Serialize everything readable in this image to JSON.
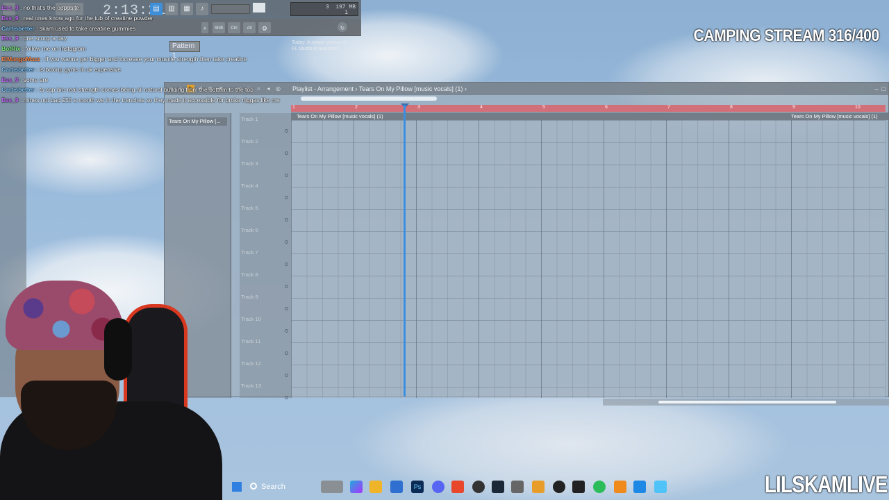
{
  "stream": {
    "title": "CAMPING STREAM 316/400",
    "brand": "LILSKAMLIVE"
  },
  "toolbar": {
    "clock": "2:13:21",
    "clock_sub": "BT",
    "cpu_label": "3",
    "memory": "197 MB",
    "voices": "1",
    "pattern_label": "Pattern 1",
    "update_notice": "Today: A newer version of FL Studio is available!",
    "mode_buttons": [
      "Shift",
      "Ctrl",
      "Alt"
    ]
  },
  "chat": [
    {
      "user": "Ess_9",
      "text": "no that's the opposite",
      "color": "#c86cff"
    },
    {
      "user": "Ess_9",
      "text": "real ones know ago for the tub of creatine powder",
      "color": "#c86cff"
    },
    {
      "user": "Cartisbetter",
      "text": "skam used to take creatine gummies",
      "color": "#7ec8ff"
    },
    {
      "user": "Ess_9",
      "text": "one scoop a day",
      "color": "#c86cff"
    },
    {
      "user": "BotRix",
      "text": "follow me on instagram",
      "color": "#7ef07e"
    },
    {
      "user": "ElMangoMazz",
      "text": "If you wanna get bigger and increase your muscle strength then take creatine",
      "color": "#ff8a4a"
    },
    {
      "user": "Cartisbetter",
      "text": "is boxing gyms in uk expensive",
      "color": "#7ec8ff"
    },
    {
      "user": "Ess_9",
      "text": "some are",
      "color": "#c86cff"
    },
    {
      "user": "Cartisbetter",
      "text": "ts cap bro real strength comes being all natural building from the bottom to the top",
      "color": "#7ec8ff"
    },
    {
      "user": "Ess_9",
      "text": "mines not bad £50 a month we in the trenches so they made it accessible for broke niggas like me",
      "color": "#c86cff"
    }
  ],
  "playlist": {
    "window_title": "Playlist - Arrangement",
    "breadcrumb": "Tears On My Pillow [music vocals] (1)",
    "picker_item": "Tears On My Pillow [...",
    "clip_name": "Tears On My Pillow [music vocals] (1)",
    "ruler_numbers": [
      "1",
      "2",
      "3",
      "4",
      "5",
      "6",
      "7",
      "8",
      "9",
      "10"
    ],
    "tracks": [
      "Track 1",
      "Track 2",
      "Track 3",
      "Track 4",
      "Track 5",
      "Track 6",
      "Track 7",
      "Track 8",
      "Track 9",
      "Track 10",
      "Track 11",
      "Track 12",
      "Track 13"
    ],
    "playhead_bar": 2.8
  },
  "taskbar": {
    "search_label": "Search"
  },
  "colors": {
    "ruler": "#d2707a",
    "playhead": "#3a8fe0",
    "chair_trim": "#d8381f"
  }
}
